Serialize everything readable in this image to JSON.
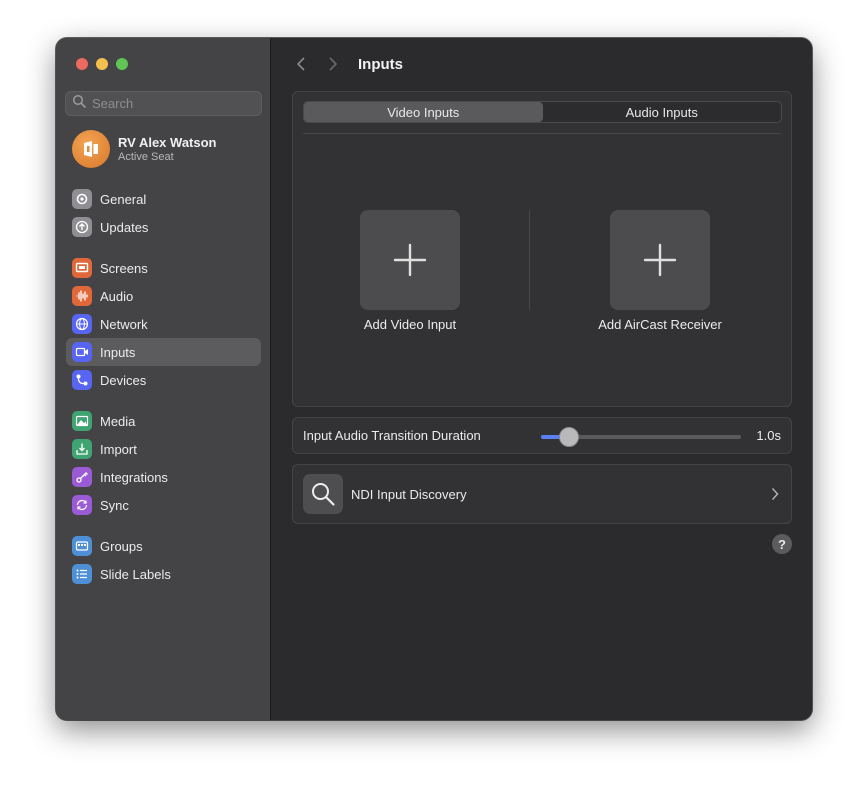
{
  "window": {
    "traffic_lights": [
      "close",
      "minimize",
      "zoom"
    ]
  },
  "sidebar": {
    "search_placeholder": "Search",
    "account": {
      "name": "RV Alex Watson",
      "subtitle": "Active Seat"
    },
    "groups": [
      [
        {
          "label": "General",
          "icon": "gear-icon",
          "color": "#8e8e93"
        },
        {
          "label": "Updates",
          "icon": "update-arrow-icon",
          "color": "#8e8e93"
        }
      ],
      [
        {
          "label": "Screens",
          "icon": "screens-icon",
          "color": "#e0673a"
        },
        {
          "label": "Audio",
          "icon": "waveform-icon",
          "color": "#e0673a"
        },
        {
          "label": "Network",
          "icon": "globe-icon",
          "color": "#5865f2"
        },
        {
          "label": "Inputs",
          "icon": "video-input-icon",
          "color": "#5865f2",
          "active": true
        },
        {
          "label": "Devices",
          "icon": "devices-icon",
          "color": "#5865f2"
        }
      ],
      [
        {
          "label": "Media",
          "icon": "media-icon",
          "color": "#3fa372"
        },
        {
          "label": "Import",
          "icon": "import-icon",
          "color": "#3fa372"
        },
        {
          "label": "Integrations",
          "icon": "integrations-icon",
          "color": "#9b5bd6"
        },
        {
          "label": "Sync",
          "icon": "sync-icon",
          "color": "#9b5bd6"
        }
      ],
      [
        {
          "label": "Groups",
          "icon": "groups-icon",
          "color": "#4f8fd6"
        },
        {
          "label": "Slide Labels",
          "icon": "slide-labels-icon",
          "color": "#4f8fd6"
        }
      ]
    ]
  },
  "main": {
    "title": "Inputs",
    "tabs": [
      {
        "label": "Video Inputs",
        "selected": true
      },
      {
        "label": "Audio Inputs",
        "selected": false
      }
    ],
    "add_video_input_label": "Add Video Input",
    "add_aircast_label": "Add AirCast Receiver",
    "transition": {
      "label": "Input Audio Transition Duration",
      "value": "1.0s",
      "level": 0.14
    },
    "ndi": {
      "label": "NDI Input Discovery"
    },
    "help_label": "?"
  },
  "colors": {
    "accent": "#5a7ff0",
    "window_bg": "#2b2b2d",
    "sidebar_bg": "#444446"
  }
}
